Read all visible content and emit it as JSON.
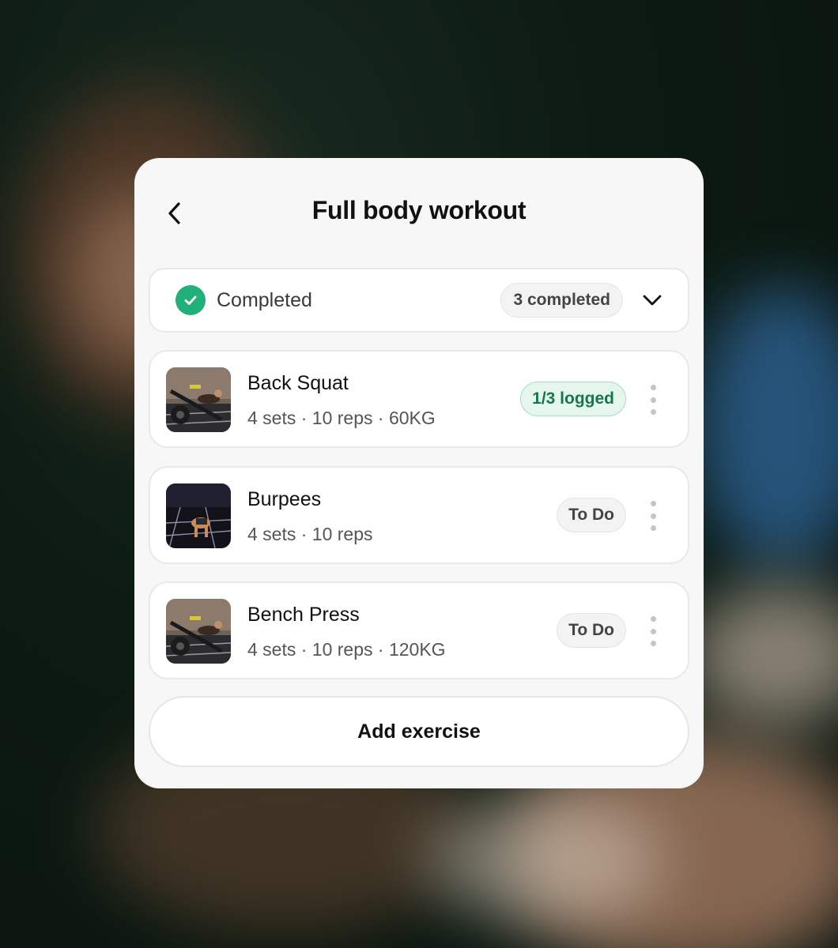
{
  "header": {
    "title": "Full body workout",
    "back_icon": "chevron-left-icon"
  },
  "completed_section": {
    "label": "Completed",
    "count_label": "3 completed",
    "status_icon": "check-circle-icon",
    "toggle_icon": "chevron-down-icon"
  },
  "exercises": [
    {
      "name": "Back Squat",
      "meta": "4 sets · 10 reps · 60KG",
      "status": "1/3 logged",
      "status_type": "logged"
    },
    {
      "name": "Burpees",
      "meta": "4 sets · 10 reps",
      "status": "To Do",
      "status_type": "todo"
    },
    {
      "name": "Bench Press",
      "meta": "4 sets · 10 reps · 120KG",
      "status": "To Do",
      "status_type": "todo"
    }
  ],
  "add_exercise_label": "Add exercise",
  "colors": {
    "success": "#22b07a",
    "logged_bg": "#e5f7ed",
    "logged_text": "#16774d",
    "card_bg": "#f7f7f7"
  }
}
